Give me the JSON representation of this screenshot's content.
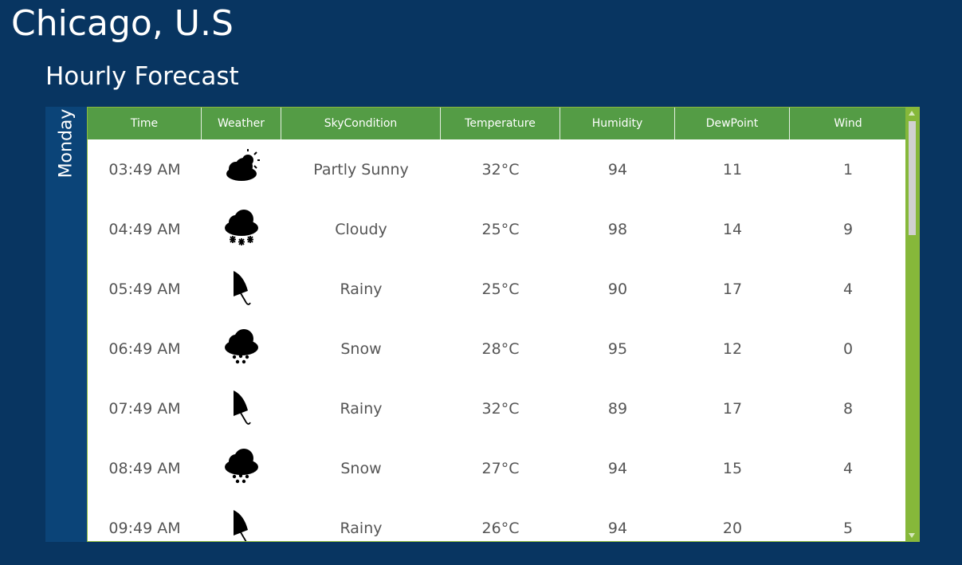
{
  "location": {
    "title": "Chicago, U.S"
  },
  "forecast": {
    "title": "Hourly Forecast",
    "day": "Monday",
    "columns": [
      "Time",
      "Weather",
      "SkyCondition",
      "Temperature",
      "Humidity",
      "DewPoint",
      "Wind"
    ],
    "rows": [
      {
        "time": "03:49 AM",
        "weather_icon": "partly-sunny-icon",
        "sky_condition": "Partly Sunny",
        "temperature": "32°C",
        "humidity": "94",
        "dew_point": "11",
        "wind": "1"
      },
      {
        "time": "04:49 AM",
        "weather_icon": "cloudy-snowflake-icon",
        "sky_condition": "Cloudy",
        "temperature": "25°C",
        "humidity": "98",
        "dew_point": "14",
        "wind": "9"
      },
      {
        "time": "05:49 AM",
        "weather_icon": "umbrella-icon",
        "sky_condition": "Rainy",
        "temperature": "25°C",
        "humidity": "90",
        "dew_point": "17",
        "wind": "4"
      },
      {
        "time": "06:49 AM",
        "weather_icon": "snow-cloud-icon",
        "sky_condition": "Snow",
        "temperature": "28°C",
        "humidity": "95",
        "dew_point": "12",
        "wind": "0"
      },
      {
        "time": "07:49 AM",
        "weather_icon": "umbrella-icon",
        "sky_condition": "Rainy",
        "temperature": "32°C",
        "humidity": "89",
        "dew_point": "17",
        "wind": "8"
      },
      {
        "time": "08:49 AM",
        "weather_icon": "snow-cloud-icon",
        "sky_condition": "Snow",
        "temperature": "27°C",
        "humidity": "94",
        "dew_point": "15",
        "wind": "4"
      },
      {
        "time": "09:49 AM",
        "weather_icon": "umbrella-icon",
        "sky_condition": "Rainy",
        "temperature": "26°C",
        "humidity": "94",
        "dew_point": "20",
        "wind": "5"
      }
    ]
  },
  "colors": {
    "background": "#083561",
    "day_panel": "#0b4478",
    "header": "#549c45",
    "scrollbar": "#86b83a",
    "text": "#555555"
  }
}
